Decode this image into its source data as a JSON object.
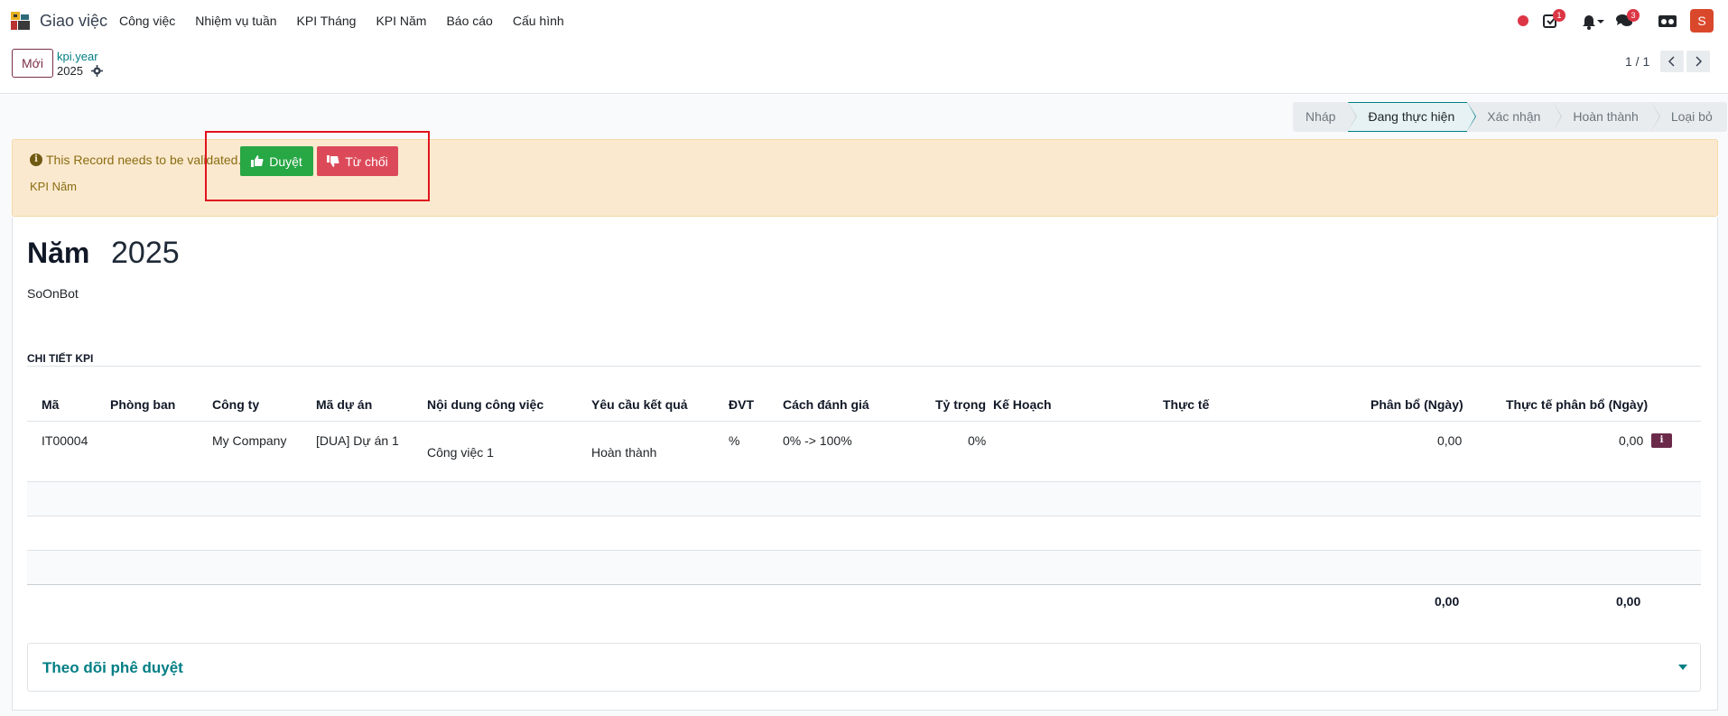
{
  "navbar": {
    "app_name": "Giao việc",
    "menu": [
      "Công việc",
      "Nhiệm vụ tuần",
      "KPI Tháng",
      "KPI Năm",
      "Báo cáo",
      "Cấu hình"
    ],
    "activity_badge": "1",
    "messages_badge": "3",
    "avatar_letter": "S"
  },
  "control": {
    "new_button": "Mới",
    "breadcrumb_model": "kpi.year",
    "breadcrumb_record": "2025",
    "pager": "1 / 1"
  },
  "statusbar": {
    "stages": [
      "Nháp",
      "Đang thực hiện",
      "Xác nhận",
      "Hoàn thành",
      "Loại bỏ"
    ],
    "active": "Đang thực hiện"
  },
  "alert": {
    "message": "This Record needs to be validated.",
    "subtitle": "KPI Năm",
    "approve_label": "Duyệt",
    "reject_label": "Từ chối"
  },
  "form": {
    "year_label": "Năm",
    "year_value": "2025",
    "owner": "SoOnBot",
    "section_title": "CHI TIẾT KPI"
  },
  "table": {
    "headers": {
      "code": "Mã",
      "department": "Phòng ban",
      "company": "Công ty",
      "project": "Mã dự án",
      "content": "Nội dung công việc",
      "requirement": "Yêu cầu kết quả",
      "unit": "ĐVT",
      "evaluation": "Cách đánh giá",
      "weight": "Tỷ trọng",
      "plan": "Kế Hoạch",
      "actual": "Thực tế",
      "allocated": "Phân bổ (Ngày)",
      "actual_allocated": "Thực tế phân bổ (Ngày)"
    },
    "rows": [
      {
        "code": "IT00004",
        "department": "",
        "company": "My Company",
        "project": "[DUA] Dự án 1",
        "content": "Công việc 1",
        "requirement": "Hoàn thành",
        "unit": "%",
        "evaluation": "0% -> 100%",
        "weight": "0%",
        "plan": "",
        "actual": "",
        "allocated": "0,00",
        "actual_allocated": "0,00"
      }
    ],
    "totals": {
      "allocated": "0,00",
      "actual_allocated": "0,00"
    }
  },
  "tracker": {
    "title": "Theo dõi phê duyệt"
  },
  "colors": {
    "accent": "#017e84",
    "brand": "#7a2e48",
    "approve": "#28a745",
    "reject": "#dc4a5a",
    "alert_bg": "#fbe9cf"
  }
}
